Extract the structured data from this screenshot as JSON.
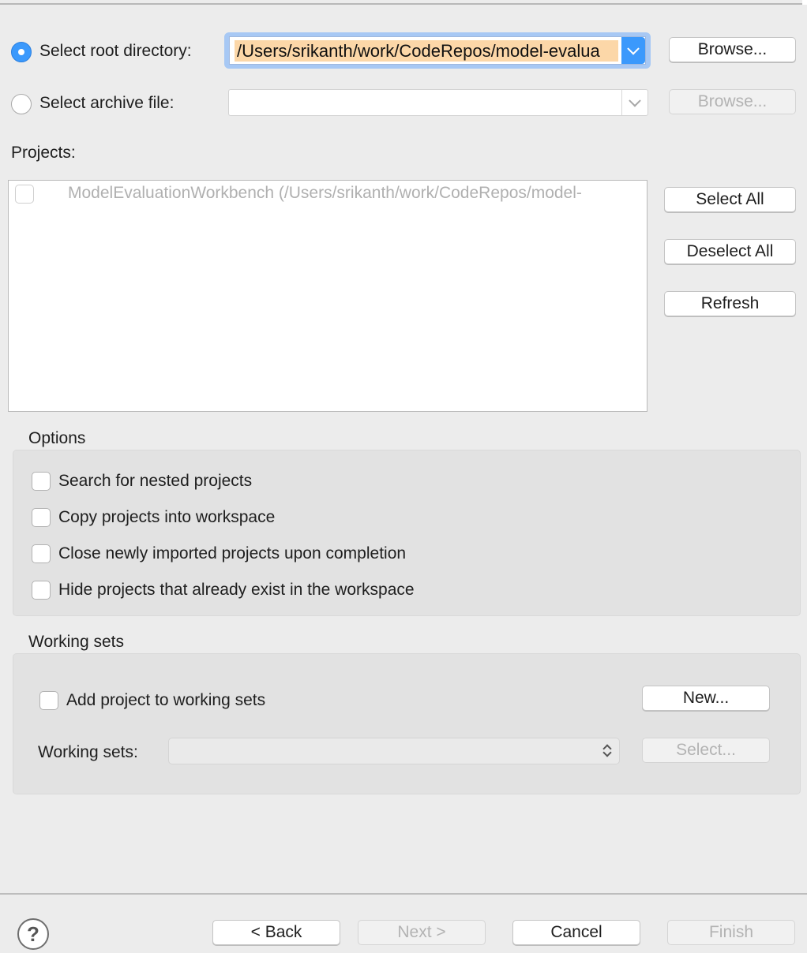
{
  "source": {
    "root_directory_label": "Select root directory:",
    "root_directory_value": "/Users/srikanth/work/CodeRepos/model-evalua",
    "archive_file_label": "Select archive file:",
    "archive_file_value": "",
    "browse_label": "Browse...",
    "browse_archive_label": "Browse..."
  },
  "projects": {
    "label": "Projects:",
    "items": [
      {
        "label": "ModelEvaluationWorkbench (/Users/srikanth/work/CodeRepos/model-",
        "checked": false
      }
    ],
    "select_all": "Select All",
    "deselect_all": "Deselect All",
    "refresh": "Refresh"
  },
  "options": {
    "title": "Options",
    "items": [
      "Search for nested projects",
      "Copy projects into workspace",
      "Close newly imported projects upon completion",
      "Hide projects that already exist in the workspace"
    ]
  },
  "working_sets": {
    "title": "Working sets",
    "add_label": "Add project to working sets",
    "new_label": "New...",
    "sets_label": "Working sets:",
    "select_label": "Select..."
  },
  "footer": {
    "help_icon": "help-icon",
    "back": "< Back",
    "next": "Next >",
    "cancel": "Cancel",
    "finish": "Finish"
  },
  "colors": {
    "accent": "#3b99fc",
    "selection_highlight": "#fcd7a8"
  }
}
